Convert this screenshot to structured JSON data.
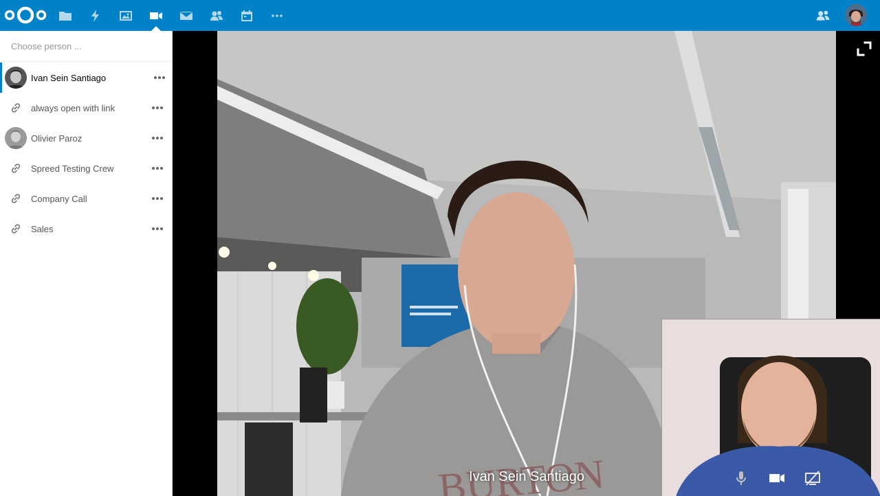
{
  "topbar": {
    "apps": [
      {
        "name": "files-icon"
      },
      {
        "name": "activity-icon"
      },
      {
        "name": "gallery-icon"
      },
      {
        "name": "talk-icon"
      },
      {
        "name": "mail-icon"
      },
      {
        "name": "contacts-icon"
      },
      {
        "name": "calendar-icon"
      },
      {
        "name": "more-apps-icon"
      }
    ],
    "accent": "#0082c9"
  },
  "sidebar": {
    "search_placeholder": "Choose person ...",
    "rooms": [
      {
        "label": "Ivan Sein Santiago",
        "type": "user"
      },
      {
        "label": "always open with link",
        "type": "link"
      },
      {
        "label": "Olivier Paroz",
        "type": "user"
      },
      {
        "label": "Spreed Testing Crew",
        "type": "link"
      },
      {
        "label": "Company Call",
        "type": "link"
      },
      {
        "label": "Sales",
        "type": "link"
      }
    ]
  },
  "call": {
    "remote_name": "Ivan Sein Santiago"
  }
}
